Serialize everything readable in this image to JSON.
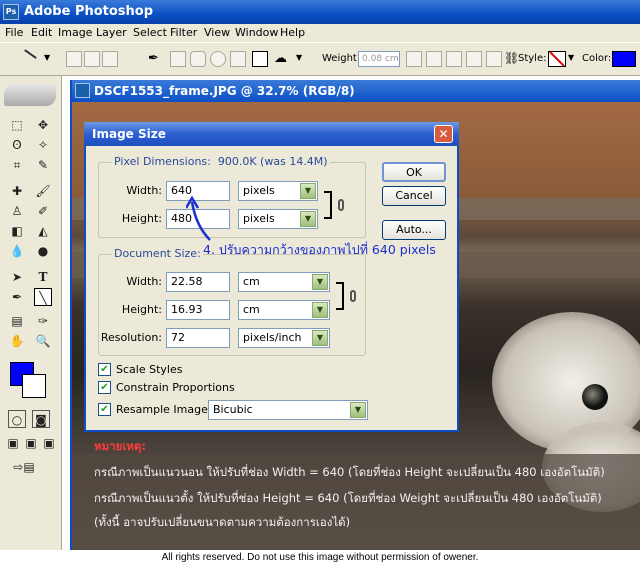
{
  "app": {
    "title": "Adobe Photoshop",
    "logo_icon": "photoshop-icon"
  },
  "menu": [
    "File",
    "Edit",
    "Image",
    "Layer",
    "Select",
    "Filter",
    "View",
    "Window",
    "Help"
  ],
  "options_bar": {
    "weight_label": "Weight:",
    "weight_value": "0.08 cm",
    "style_label": "Style:",
    "color_label": "Color:",
    "color": "#0000ff"
  },
  "toolbox": {
    "foreground_color": "#0000ff",
    "background_color": "#ffffff"
  },
  "document": {
    "title": "DSCF1553_frame.JPG @ 32.7% (RGB/8)"
  },
  "dialog": {
    "title": "Image Size",
    "pixel_dimensions": {
      "label": "Pixel Dimensions:",
      "size": "900.0K (was 14.4M)",
      "width_label": "Width:",
      "width_value": "640",
      "width_unit": "pixels",
      "height_label": "Height:",
      "height_value": "480",
      "height_unit": "pixels"
    },
    "document_size": {
      "label": "Document Size:",
      "width_label": "Width:",
      "width_value": "22.58",
      "width_unit": "cm",
      "height_label": "Height:",
      "height_value": "16.93",
      "height_unit": "cm",
      "resolution_label": "Resolution:",
      "resolution_value": "72",
      "resolution_unit": "pixels/inch"
    },
    "buttons": {
      "ok": "OK",
      "cancel": "Cancel",
      "auto": "Auto..."
    },
    "checkboxes": {
      "scale_styles": "Scale Styles",
      "constrain_proportions": "Constrain Proportions",
      "resample_image": "Resample Image:"
    },
    "resample_method": "Bicubic"
  },
  "annotation": "4. ปรับความกว้างของภาพไปที่ 640 pixels",
  "note": {
    "heading": "หมายเหตุ:",
    "line1": "กรณีภาพเป็นแนวนอน ให้ปรับที่ช่อง Width = 640 (โดยที่ช่อง Height จะเปลี่ยนเป็น 480 เองอัตโนมัติ)",
    "line2": "กรณีภาพเป็นแนวตั้ง ให้ปรับที่ช่อง Height = 640 (โดยที่ช่อง Weight จะเปลี่ยนเป็น 480 เองอัตโนมัติ)",
    "line3": "(ทั้งนี้ อาจปรับเปลี่ยนขนาดตามความต้องการเองได้)"
  },
  "footer": "All rights reserved. Do not use this image without permission of owener."
}
